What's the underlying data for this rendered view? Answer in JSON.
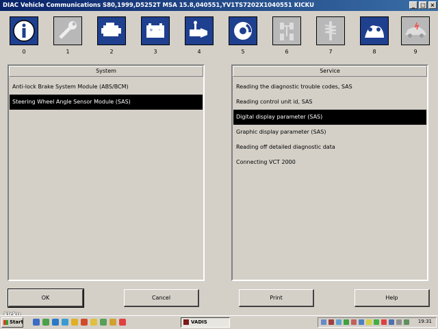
{
  "window": {
    "title": "DIAC  Vehicle Communications S80,1999,D5252T MSA 15.8,040551,YV1TS7202X1040551 KICKU",
    "buttons": [
      "_",
      "□",
      "×"
    ]
  },
  "toolbar": {
    "tools": [
      {
        "num": "0",
        "icon": "info-icon",
        "active": true
      },
      {
        "num": "1",
        "icon": "wrench-icon",
        "active": false
      },
      {
        "num": "2",
        "icon": "engine-icon",
        "active": true
      },
      {
        "num": "3",
        "icon": "battery-icon",
        "active": true
      },
      {
        "num": "4",
        "icon": "transmission-icon",
        "active": true
      },
      {
        "num": "5",
        "icon": "brake-disc-icon",
        "active": true
      },
      {
        "num": "6",
        "icon": "steering-icon",
        "active": false
      },
      {
        "num": "7",
        "icon": "suspension-icon",
        "active": false
      },
      {
        "num": "8",
        "icon": "seat-icon",
        "active": true
      },
      {
        "num": "9",
        "icon": "car-body-icon",
        "active": false
      }
    ]
  },
  "system_panel": {
    "header": "System",
    "items": [
      "Anti-lock Brake System Module (ABS/BCM)",
      "Steering Wheel Angle Sensor Module (SAS)"
    ],
    "selected_index": 1
  },
  "service_panel": {
    "header": "Service",
    "items": [
      "Reading the diagnostic trouble codes, SAS",
      "Reading control unit id, SAS",
      "Digital display parameter (SAS)",
      "Graphic display parameter (SAS)",
      "Reading off detailed diagnostic data",
      "Connecting VCT 2000"
    ],
    "selected_index": 2
  },
  "buttons": {
    "ok": "OK",
    "cancel": "Cancel",
    "print": "Print",
    "help": "Help"
  },
  "taskbar": {
    "start_label": "Start",
    "task_label": "VADIS",
    "clock": "19:31",
    "watermark": "kicku"
  },
  "colors": {
    "icon_active_bg": "#1f3f8f",
    "icon_inactive_bg": "#b8b8b8",
    "selection_bg": "#000000",
    "title_bar": "#0a246a"
  }
}
